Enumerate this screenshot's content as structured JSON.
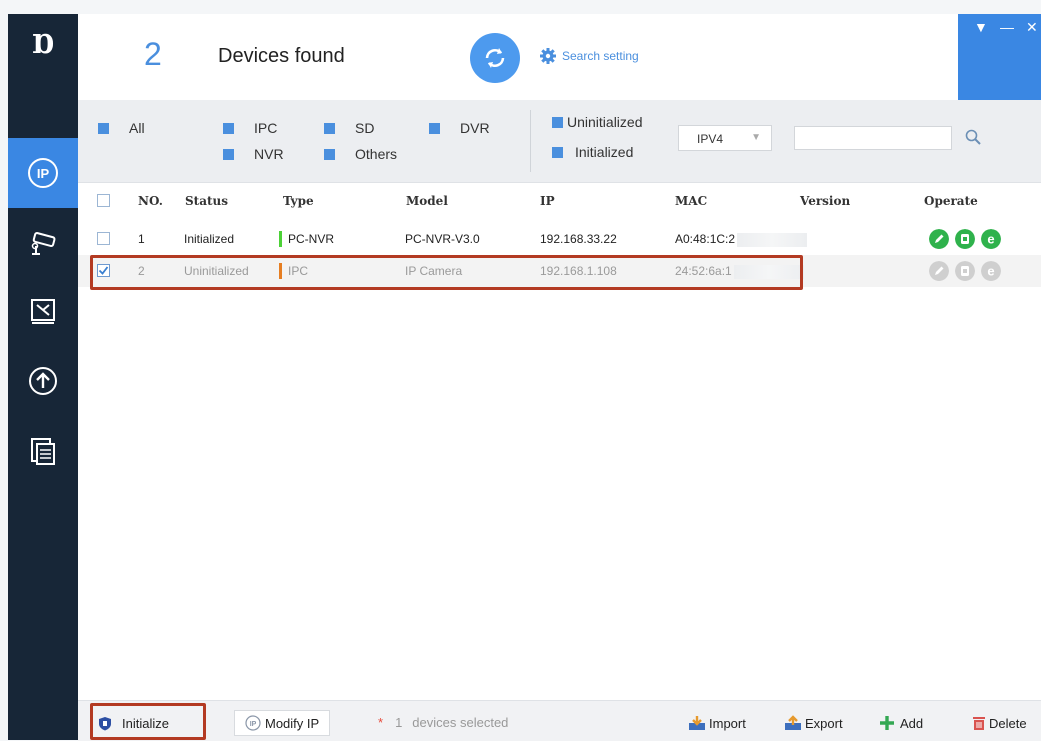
{
  "app": {
    "logo": "Ɒ"
  },
  "header": {
    "found_count": "2",
    "found_label": "Devices found",
    "search_setting": "Search setting"
  },
  "filters": {
    "all": "All",
    "ipc": "IPC",
    "sd": "SD",
    "dvr": "DVR",
    "nvr": "NVR",
    "others": "Others",
    "uninitialized": "Uninitialized",
    "initialized": "Initialized",
    "ip_version": "IPV4",
    "search_value": ""
  },
  "table": {
    "columns": {
      "no": "NO.",
      "status": "Status",
      "type": "Type",
      "model": "Model",
      "ip": "IP",
      "mac": "MAC",
      "version": "Version",
      "operate": "Operate"
    },
    "rows": [
      {
        "no": "1",
        "status": "Initialized",
        "type": "PC-NVR",
        "model": "PC-NVR-V3.0",
        "ip": "192.168.33.22",
        "mac": "A0:48:1C:2",
        "version": "",
        "type_color": "#4cd137",
        "checked": false
      },
      {
        "no": "2",
        "status": "Uninitialized",
        "type": "IPC",
        "model": "IP Camera",
        "ip": "192.168.1.108",
        "mac": "24:52:6a:1",
        "version": "",
        "type_color": "#e67e22",
        "checked": true
      }
    ]
  },
  "footer": {
    "initialize": "Initialize",
    "modify_ip": "Modify IP",
    "selected_count": "1",
    "selected_label": "devices selected",
    "import": "Import",
    "export": "Export",
    "add": "Add",
    "delete": "Delete"
  },
  "colors": {
    "sidebar": "#172637",
    "accent": "#3a87e3",
    "highlight": "#b33a22",
    "op_active": "#2fb24c",
    "op_disabled": "#c8c8c8"
  }
}
